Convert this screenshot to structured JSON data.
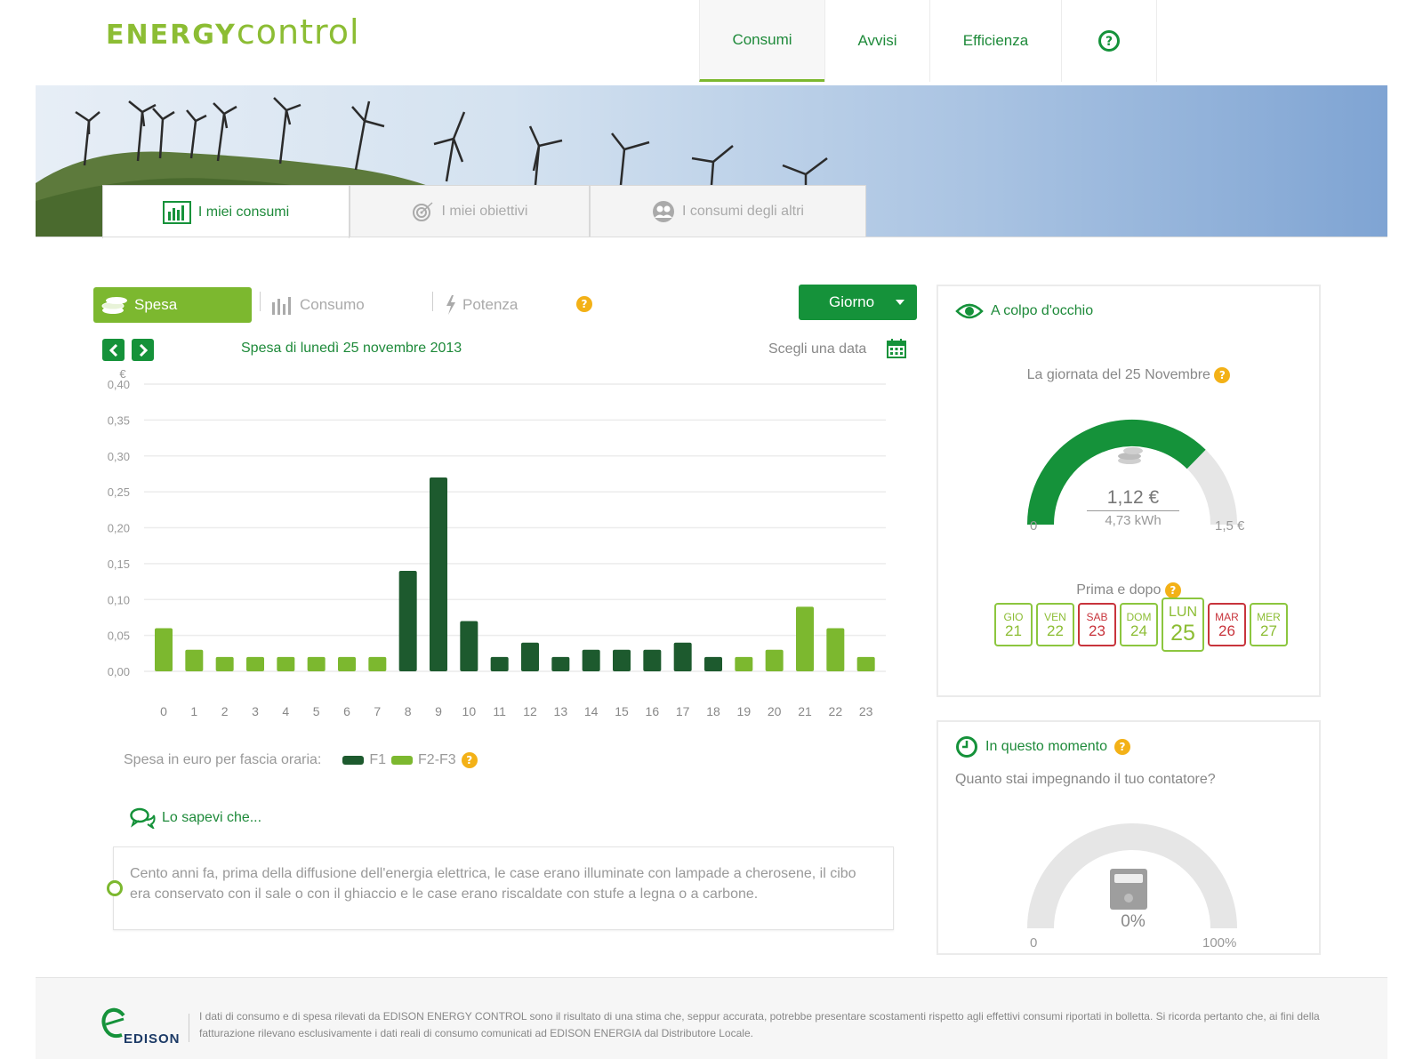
{
  "header": {
    "logo_bold": "ENERGY",
    "logo_light": "control",
    "nav": [
      {
        "label": "Consumi",
        "active": true
      },
      {
        "label": "Avvisi",
        "active": false
      },
      {
        "label": "Efficienza",
        "active": false
      }
    ],
    "help_icon": "question-circle-icon"
  },
  "subtabs": [
    {
      "label": "I miei consumi",
      "icon": "bar-chart-icon",
      "active": true
    },
    {
      "label": "I miei obiettivi",
      "icon": "target-icon",
      "active": false
    },
    {
      "label": "I consumi degli altri",
      "icon": "users-icon",
      "active": false
    }
  ],
  "chart_controls": {
    "tabs": [
      "Spesa",
      "Consumo",
      "Potenza"
    ],
    "period": "Giorno",
    "title": "Spesa di lunedì 25 novembre 2013",
    "date_picker_label": "Scegli una data"
  },
  "chart_data": {
    "type": "bar",
    "ylabel": "€",
    "ylim": [
      0,
      0.4
    ],
    "yticks": [
      "0,00",
      "0,05",
      "0,10",
      "0,15",
      "0,20",
      "0,25",
      "0,30",
      "0,35",
      "0,40"
    ],
    "categories": [
      "0",
      "1",
      "2",
      "3",
      "4",
      "5",
      "6",
      "7",
      "8",
      "9",
      "10",
      "11",
      "12",
      "13",
      "14",
      "15",
      "16",
      "17",
      "18",
      "19",
      "20",
      "21",
      "22",
      "23"
    ],
    "values": [
      0.06,
      0.03,
      0.02,
      0.02,
      0.02,
      0.02,
      0.02,
      0.02,
      0.14,
      0.27,
      0.07,
      0.02,
      0.04,
      0.02,
      0.03,
      0.03,
      0.03,
      0.04,
      0.02,
      0.02,
      0.03,
      0.09,
      0.06,
      0.02
    ],
    "band": [
      "F2-F3",
      "F2-F3",
      "F2-F3",
      "F2-F3",
      "F2-F3",
      "F2-F3",
      "F2-F3",
      "F2-F3",
      "F1",
      "F1",
      "F1",
      "F1",
      "F1",
      "F1",
      "F1",
      "F1",
      "F1",
      "F1",
      "F1",
      "F2-F3",
      "F2-F3",
      "F2-F3",
      "F2-F3",
      "F2-F3"
    ],
    "colors": {
      "F1": "#1d5a2e",
      "F2-F3": "#7cb82f"
    },
    "grid": true
  },
  "legend": {
    "prefix": "Spesa in euro per fascia oraria:",
    "items": [
      {
        "label": "F1",
        "color": "#1d5a2e"
      },
      {
        "label": "F2-F3",
        "color": "#7cb82f"
      }
    ]
  },
  "sapevi": {
    "title": "Lo sapevi che...",
    "text": "Cento anni fa, prima della diffusione dell'energia elettrica, le case erano illuminate con lampade a cherosene, il cibo era conservato con il sale o con il ghiaccio e le case erano riscaldate con stufe a legna o a carbone."
  },
  "glance": {
    "title": "A colpo d'occhio",
    "subtitle": "La giornata del 25 Novembre",
    "gauge_value": "1,12 €",
    "gauge_sub": "4,73 kWh",
    "gauge_min": "0",
    "gauge_max": "1,5 €",
    "gauge_fraction": 0.747,
    "prima_dopo_title": "Prima e dopo",
    "days": [
      {
        "d": "GIO",
        "n": "21",
        "state": "ok"
      },
      {
        "d": "VEN",
        "n": "22",
        "state": "ok"
      },
      {
        "d": "SAB",
        "n": "23",
        "state": "over"
      },
      {
        "d": "DOM",
        "n": "24",
        "state": "ok"
      },
      {
        "d": "LUN",
        "n": "25",
        "state": "current"
      },
      {
        "d": "MAR",
        "n": "26",
        "state": "over"
      },
      {
        "d": "MER",
        "n": "27",
        "state": "ok"
      }
    ]
  },
  "moment": {
    "title": "In questo momento",
    "question": "Quanto stai impegnando il tuo contatore?",
    "value": "0%",
    "min": "0",
    "max": "100%",
    "fraction": 0
  },
  "footer": {
    "brand": "EDISON",
    "text": "I dati di consumo e di spesa rilevati da EDISON ENERGY CONTROL sono il risultato di una stima che, seppur accurata, potrebbe presentare scostamenti rispetto agli effettivi consumi riportati in bolletta. Si ricorda pertanto che, ai fini della fatturazione rilevano esclusivamente i dati reali di consumo comunicati ad EDISON ENERGIA dal Distributore Locale."
  }
}
